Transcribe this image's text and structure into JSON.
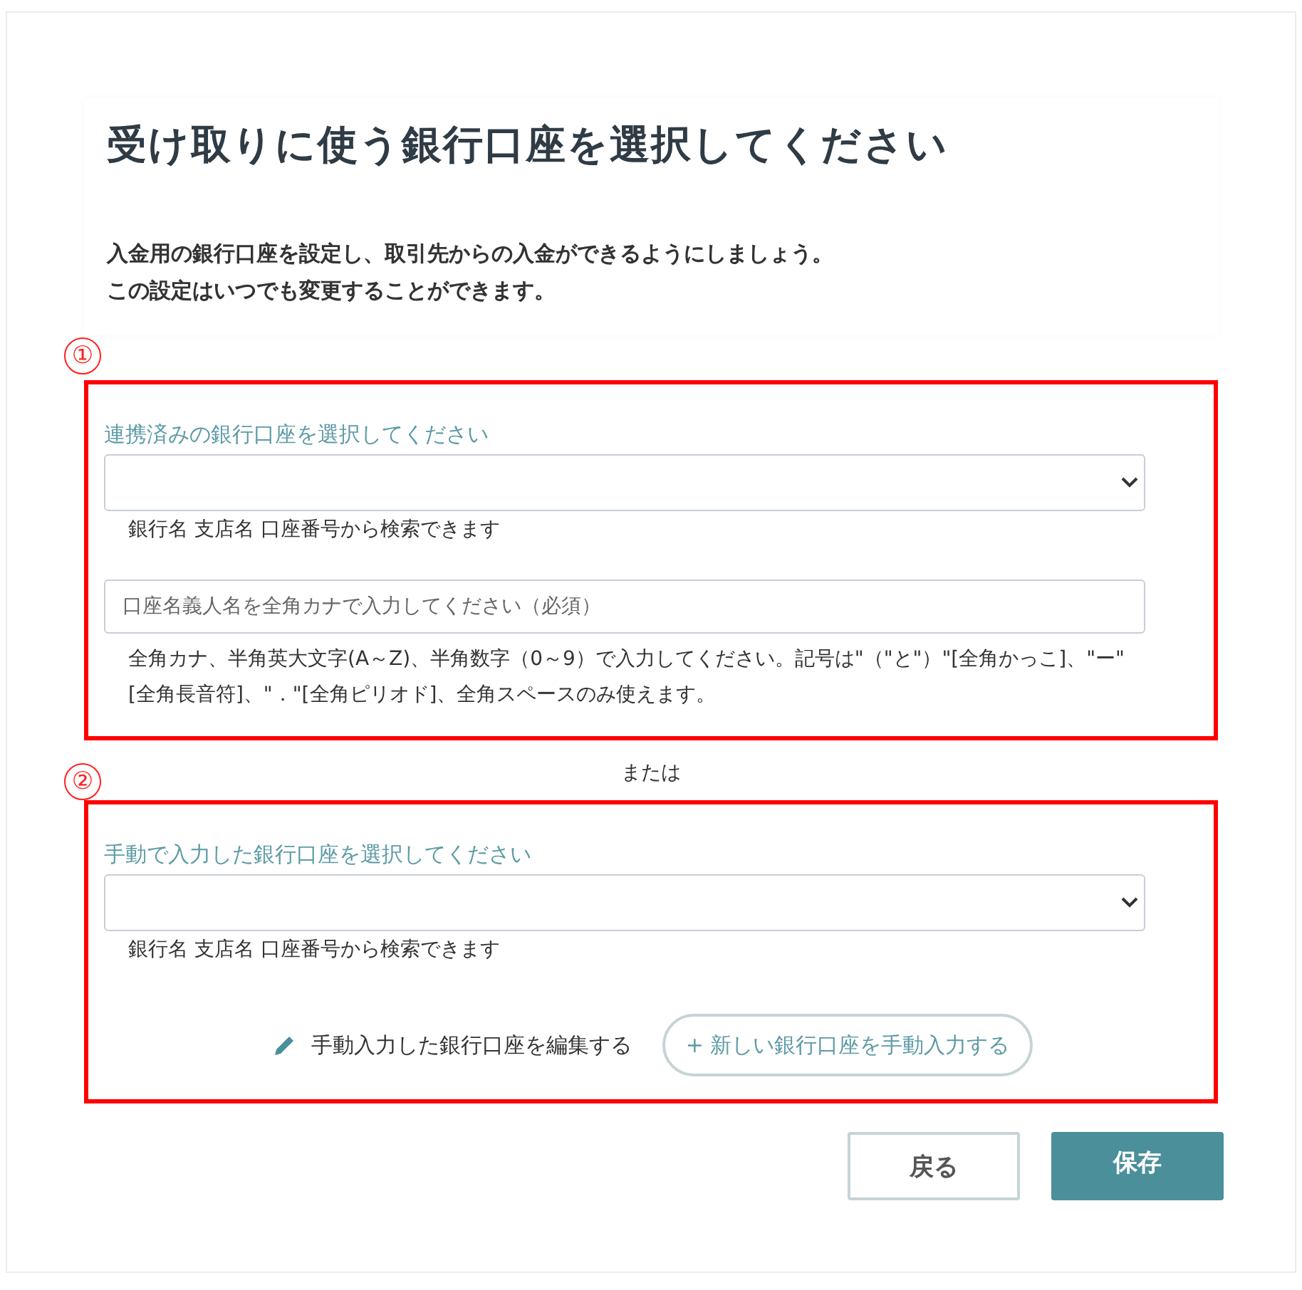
{
  "title": "受け取りに使う銀行口座を選択してください",
  "description": [
    "入金用の銀行口座を設定し、取引先からの入金ができるようにしましょう。",
    "この設定はいつでも変更することができます。"
  ],
  "sections": [
    {
      "marker": "①",
      "label": "連携済みの銀行口座を選択してください",
      "select_hint": "銀行名 支店名 口座番号から検索できます",
      "name_field": {
        "placeholder": "口座名義人名を全角カナで入力してください（必須）",
        "note": "全角カナ、半角英大文字(A～Z)、半角数字（0～9）で入力してください。記号は\"（\"と\"）\"[全角かっこ]、\"ー\"[全角長音符]、\"．\"[全角ピリオド]、全角スペースのみ使えます。"
      }
    },
    {
      "marker": "②",
      "label": "手動で入力した銀行口座を選択してください",
      "select_hint": "銀行名 支店名 口座番号から検索できます",
      "actions": {
        "edit": "手動入力した銀行口座を編集する",
        "add": "+ 新しい銀行口座を手動入力する"
      }
    }
  ],
  "separator": "または",
  "buttons": {
    "back": "戻る",
    "save": "保存"
  }
}
